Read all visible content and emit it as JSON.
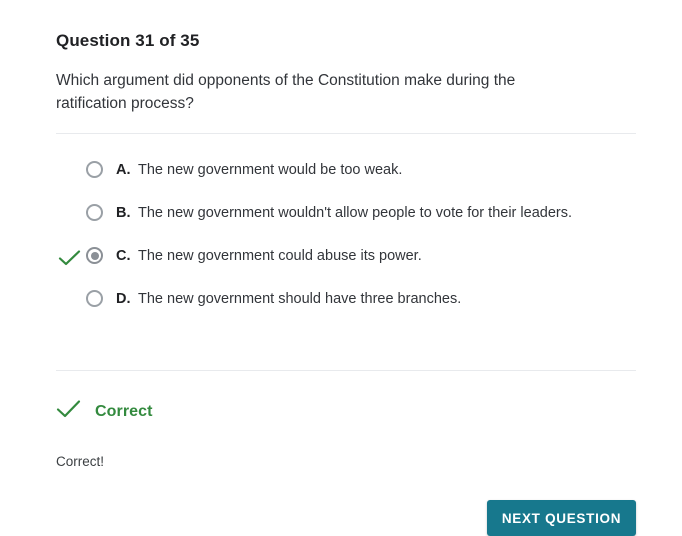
{
  "quiz": {
    "header": "Question 31 of 35",
    "question": "Which argument did opponents of the Constitution make during the ratification process?",
    "options": [
      {
        "letter": "A.",
        "text": "The new government would be too weak.",
        "selected": false,
        "marked_correct": false
      },
      {
        "letter": "B.",
        "text": "The new government wouldn't allow people to vote for their leaders.",
        "selected": false,
        "marked_correct": false
      },
      {
        "letter": "C.",
        "text": "The new government could abuse its power.",
        "selected": true,
        "marked_correct": true
      },
      {
        "letter": "D.",
        "text": "The new government should have three branches.",
        "selected": false,
        "marked_correct": false
      }
    ],
    "feedback": {
      "status": "Correct",
      "detail": "Correct!",
      "status_color": "#338a3e"
    },
    "next_button": {
      "label": "NEXT QUESTION",
      "color": "#17788d"
    }
  }
}
